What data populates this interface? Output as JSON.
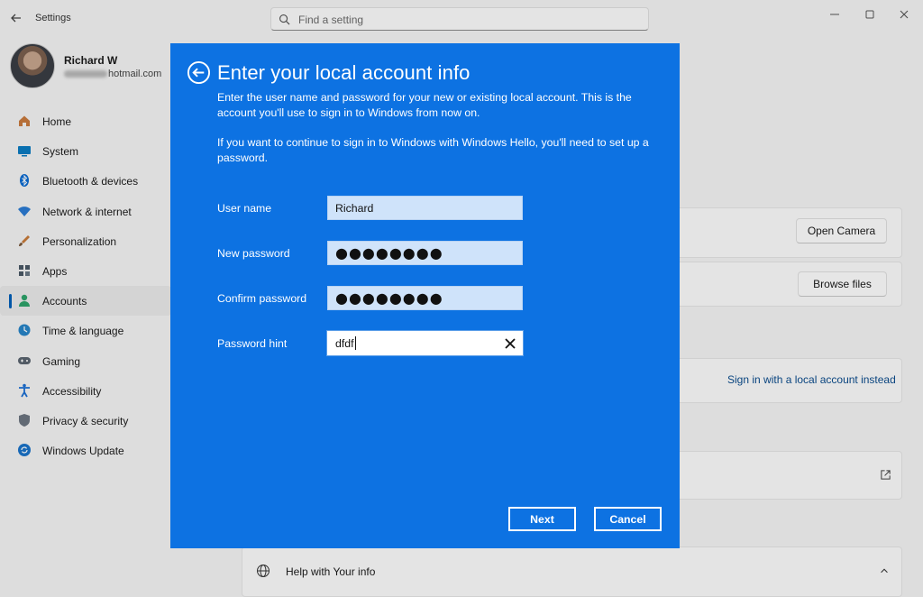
{
  "app": {
    "title": "Settings"
  },
  "search": {
    "placeholder": "Find a setting"
  },
  "profile": {
    "name": "Richard W",
    "email_suffix": "hotmail.com"
  },
  "nav": {
    "items": [
      {
        "label": "Home",
        "icon": "home-icon",
        "color": "#c97a3e"
      },
      {
        "label": "System",
        "icon": "monitor-icon",
        "color": "#0a7cc2"
      },
      {
        "label": "Bluetooth & devices",
        "icon": "bluetooth-icon",
        "color": "#0b6bd1"
      },
      {
        "label": "Network & internet",
        "icon": "wifi-icon",
        "color": "#2b7cd3"
      },
      {
        "label": "Personalization",
        "icon": "brush-icon",
        "color": "#c77a3a"
      },
      {
        "label": "Apps",
        "icon": "apps-icon",
        "color": "#4a5866"
      },
      {
        "label": "Accounts",
        "icon": "person-icon",
        "color": "#2ea36a"
      },
      {
        "label": "Time & language",
        "icon": "globe-clock-icon",
        "color": "#2784c7"
      },
      {
        "label": "Gaming",
        "icon": "gamepad-icon",
        "color": "#5b6470"
      },
      {
        "label": "Accessibility",
        "icon": "accessibility-icon",
        "color": "#1c6fd4"
      },
      {
        "label": "Privacy & security",
        "icon": "shield-icon",
        "color": "#6c7580"
      },
      {
        "label": "Windows Update",
        "icon": "update-icon",
        "color": "#1a73c9"
      }
    ],
    "active_index": 6
  },
  "background": {
    "open_camera": "Open Camera",
    "browse_files": "Browse files",
    "local_account_link": "Sign in with a local account instead",
    "help_title": "Help with Your info"
  },
  "dialog": {
    "title": "Enter your local account info",
    "para1": "Enter the user name and password for your new or existing local account. This is the account you'll use to sign in to Windows from now on.",
    "para2": "If you want to continue to sign in to Windows with Windows Hello, you'll need to set up a password.",
    "fields": {
      "username": {
        "label": "User name",
        "value": "Richard"
      },
      "new_password": {
        "label": "New password",
        "value": "●●●●●●●●"
      },
      "confirm_password": {
        "label": "Confirm password",
        "value": "●●●●●●●●"
      },
      "hint": {
        "label": "Password hint",
        "value": "dfdf"
      }
    },
    "next_label": "Next",
    "cancel_label": "Cancel",
    "accent_color": "#0d72e2"
  }
}
